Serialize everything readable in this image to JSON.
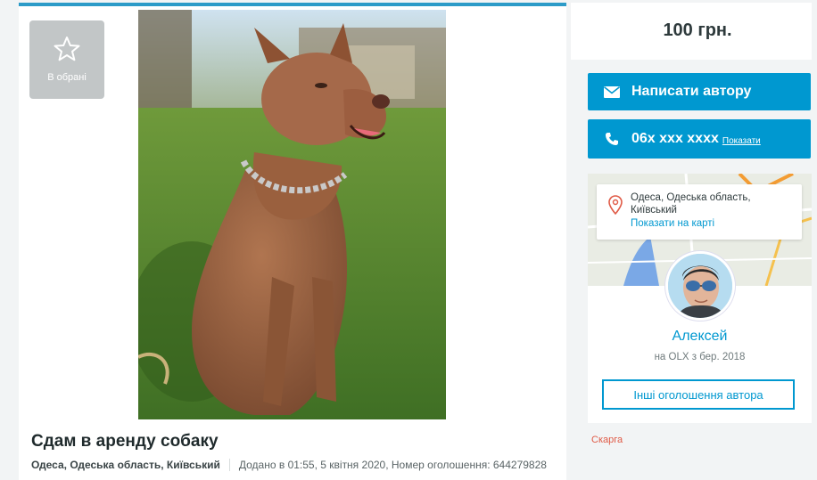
{
  "favorite": {
    "label": "В обрані",
    "icon": "star-outline-icon"
  },
  "listing": {
    "title": "Сдам в аренду собаку",
    "location": "Одеса, Одеська область, Київський",
    "added": "Додано в 01:55, 5 квітня 2020, Номер оголошення: 644279828"
  },
  "price": "100 грн.",
  "actions": {
    "write_label": "Написати автору",
    "phone_label": "06x xxx xxxx",
    "phone_show": "Показати"
  },
  "map": {
    "address": "Одеса, Одеська область, Київський",
    "show_on_map": "Показати на карті"
  },
  "seller": {
    "name": "Алексей",
    "since": "на OLX з бер. 2018",
    "other_ads": "Інші оголошення автора"
  },
  "report_label": "Скарга",
  "colors": {
    "accent": "#0098d0",
    "report": "#e05a46",
    "fav_bg": "#c2c6c7"
  }
}
